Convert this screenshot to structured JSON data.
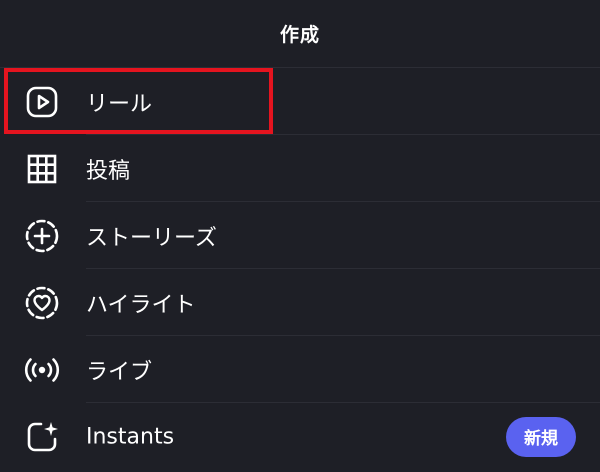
{
  "header": {
    "title": "作成"
  },
  "menu": {
    "items": [
      {
        "label": "リール",
        "icon": "reels-icon"
      },
      {
        "label": "投稿",
        "icon": "grid-icon"
      },
      {
        "label": "ストーリーズ",
        "icon": "story-add-icon"
      },
      {
        "label": "ハイライト",
        "icon": "highlight-heart-icon"
      },
      {
        "label": "ライブ",
        "icon": "live-broadcast-icon"
      },
      {
        "label": "Instants",
        "icon": "instants-icon",
        "badge": "新規"
      }
    ]
  },
  "colors": {
    "background": "#1e1f26",
    "separator": "#2c2d35",
    "highlight_border": "#e5141f",
    "badge": "#5a62f0",
    "text": "#ffffff"
  }
}
